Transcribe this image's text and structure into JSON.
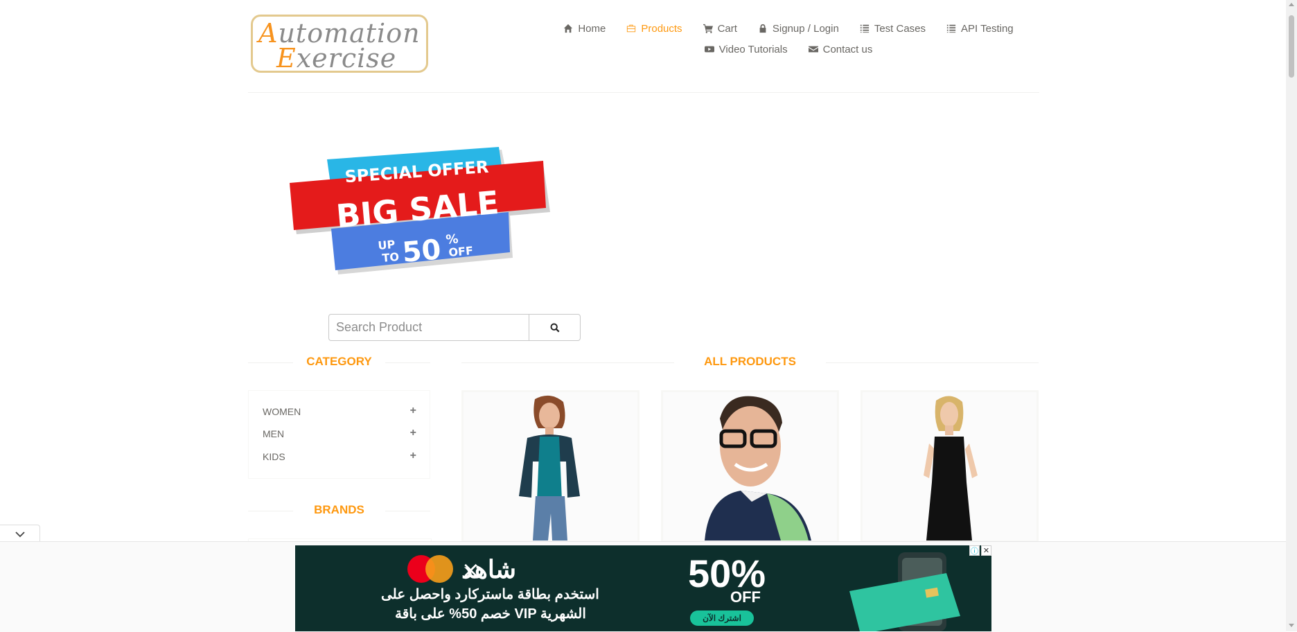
{
  "logo": {
    "line1_cap": "A",
    "line1_rest": "utomation",
    "line2_cap": "E",
    "line2_rest": "xercise"
  },
  "nav": {
    "items": [
      {
        "label": "Home",
        "icon": "home-icon"
      },
      {
        "label": "Products",
        "icon": "products-icon",
        "active": true
      },
      {
        "label": "Cart",
        "icon": "cart-icon"
      },
      {
        "label": "Signup / Login",
        "icon": "lock-icon"
      },
      {
        "label": "Test Cases",
        "icon": "list-icon"
      },
      {
        "label": "API Testing",
        "icon": "list-icon"
      },
      {
        "label": "Video Tutorials",
        "icon": "youtube-icon"
      },
      {
        "label": "Contact us",
        "icon": "envelope-icon"
      }
    ]
  },
  "banner": {
    "line1": "SPECIAL OFFER",
    "line2": "BIG SALE",
    "up": "UP",
    "to": "TO",
    "amount": "50",
    "percent": "%",
    "off": "OFF"
  },
  "search": {
    "placeholder": "Search Product",
    "value": ""
  },
  "sidebar": {
    "category_title": "CATEGORY",
    "categories": [
      {
        "label": "WOMEN",
        "toggle": "+"
      },
      {
        "label": "MEN",
        "toggle": "+"
      },
      {
        "label": "KIDS",
        "toggle": "+"
      }
    ],
    "brands_title": "BRANDS"
  },
  "main": {
    "title": "ALL PRODUCTS"
  },
  "ad": {
    "brand": "شاهد",
    "percent": "50%",
    "off": "OFF",
    "line1": "استخدم بطاقة ماستركارد واحصل على",
    "line2": "خصم 50% على باقة VIP الشهرية",
    "cta": "اشترك الآن"
  },
  "colors": {
    "accent": "#fe980f",
    "text": "#696763",
    "ad_bg": "#0d2f2c"
  }
}
